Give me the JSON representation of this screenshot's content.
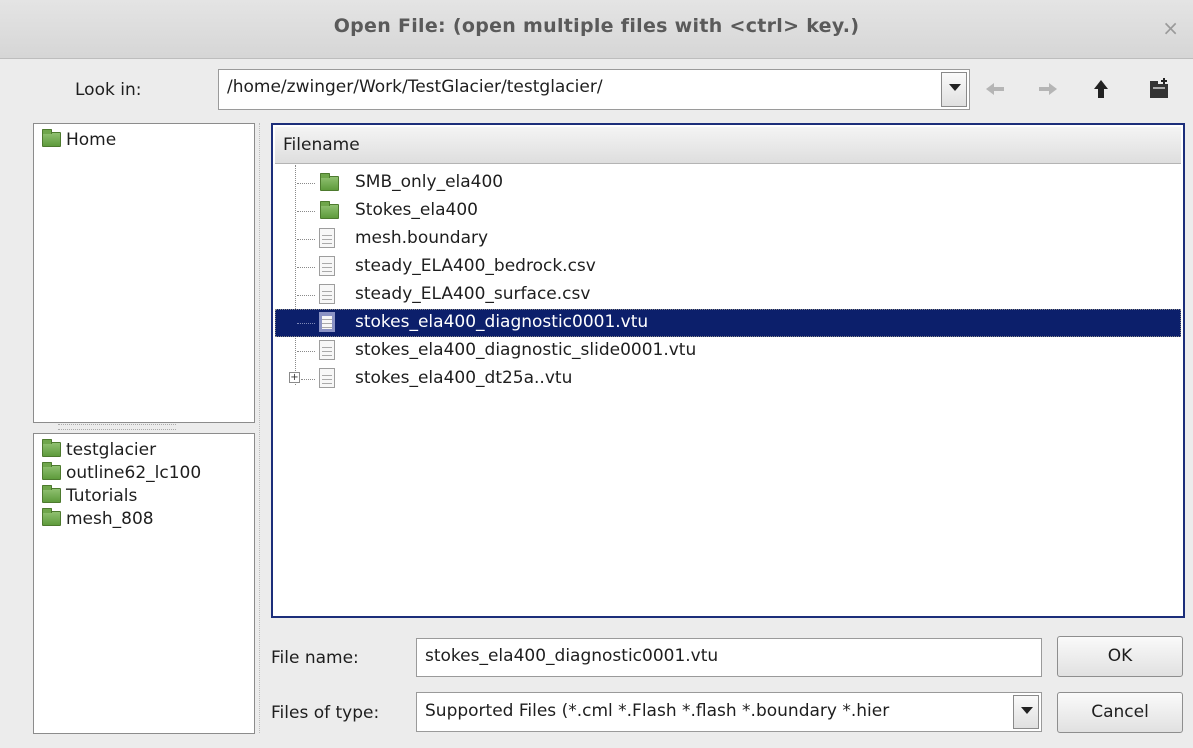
{
  "window": {
    "title": "Open File:  (open multiple files with <ctrl> key.)",
    "close_glyph": "×"
  },
  "look_in": {
    "label": "Look in:",
    "path": "/home/zwinger/Work/TestGlacier/testglacier/"
  },
  "nav_icons": [
    "back-arrow-icon",
    "forward-arrow-icon",
    "up-arrow-icon",
    "new-folder-icon"
  ],
  "places": {
    "top": [
      {
        "label": "Home"
      }
    ],
    "recent": [
      {
        "label": "testglacier"
      },
      {
        "label": "outline62_lc100"
      },
      {
        "label": "Tutorials"
      },
      {
        "label": "mesh_808"
      }
    ]
  },
  "file_list": {
    "header": "Filename",
    "items": [
      {
        "name": "SMB_only_ela400",
        "type": "folder",
        "selected": false,
        "expandable": false
      },
      {
        "name": "Stokes_ela400",
        "type": "folder",
        "selected": false,
        "expandable": false
      },
      {
        "name": "mesh.boundary",
        "type": "file",
        "selected": false,
        "expandable": false
      },
      {
        "name": "steady_ELA400_bedrock.csv",
        "type": "file",
        "selected": false,
        "expandable": false
      },
      {
        "name": "steady_ELA400_surface.csv",
        "type": "file",
        "selected": false,
        "expandable": false
      },
      {
        "name": "stokes_ela400_diagnostic0001.vtu",
        "type": "file",
        "selected": true,
        "expandable": false
      },
      {
        "name": "stokes_ela400_diagnostic_slide0001.vtu",
        "type": "file",
        "selected": false,
        "expandable": false
      },
      {
        "name": "stokes_ela400_dt25a..vtu",
        "type": "file",
        "selected": false,
        "expandable": true
      }
    ]
  },
  "file_name": {
    "label": "File name:",
    "value": "stokes_ela400_diagnostic0001.vtu"
  },
  "file_type": {
    "label": "Files of type:",
    "value": "Supported Files (*.cml  *.Flash *.flash  *.boundary *.hier"
  },
  "buttons": {
    "ok": "OK",
    "cancel": "Cancel"
  },
  "colors": {
    "selection": "#0c1f6b",
    "list_border": "#1c2e7a",
    "folder": "#6fa64b"
  }
}
